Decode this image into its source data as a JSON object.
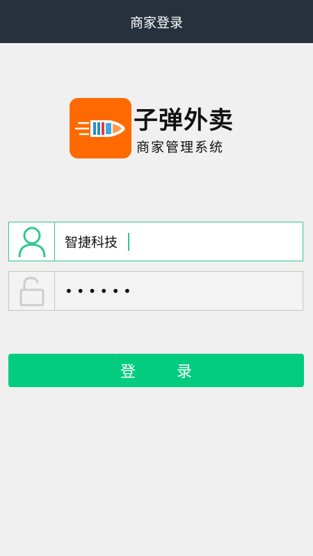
{
  "header": {
    "title": "商家登录"
  },
  "brand": {
    "name": "子弹外卖",
    "subtitle": "商家管理系统",
    "logo_color": "#ff6a00"
  },
  "form": {
    "username": {
      "value": "智捷科技",
      "icon": "user-icon"
    },
    "password": {
      "value": "••••••",
      "icon": "unlock-icon"
    },
    "submit_label": "登 录"
  },
  "colors": {
    "header_bg": "#27313e",
    "accent": "#03cc81",
    "page_bg": "#f0f0f0"
  }
}
